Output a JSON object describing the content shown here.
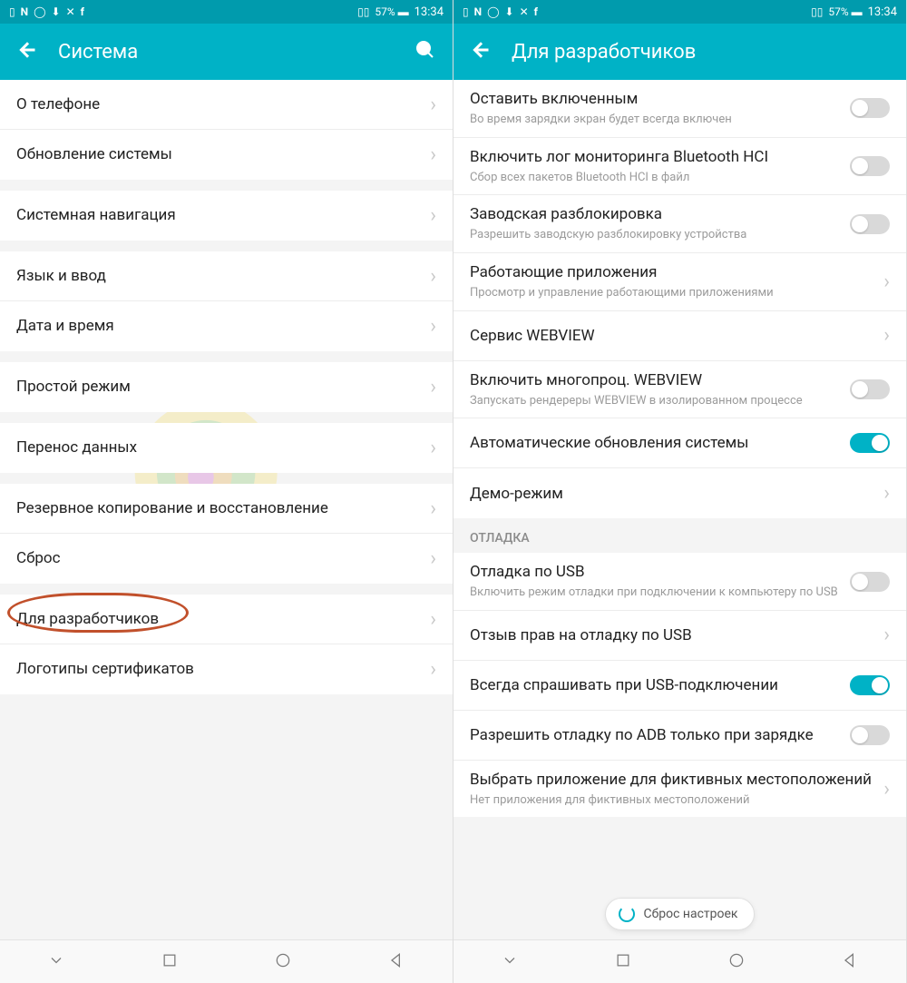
{
  "status": {
    "battery": "57%",
    "time": "13:34"
  },
  "left": {
    "appbar_title": "Система",
    "items": [
      {
        "label": "О телефоне"
      },
      {
        "label": "Обновление системы"
      }
    ],
    "items2": [
      {
        "label": "Системная навигация"
      }
    ],
    "items3": [
      {
        "label": "Язык и ввод"
      },
      {
        "label": "Дата и время"
      }
    ],
    "items4": [
      {
        "label": "Простой режим"
      }
    ],
    "items5": [
      {
        "label": "Перенос данных"
      }
    ],
    "items6": [
      {
        "label": "Резервное копирование и восстановление"
      },
      {
        "label": "Сброс"
      }
    ],
    "items7": [
      {
        "label": "Для разработчиков",
        "circled": true
      },
      {
        "label": "Логотипы сертификатов"
      }
    ]
  },
  "right": {
    "appbar_title": "Для разработчиков",
    "rows1": [
      {
        "label": "Оставить включенным",
        "sub": "Во время зарядки экран будет всегда включен",
        "toggle": false
      },
      {
        "label": "Включить лог мониторинга Bluetooth HCI",
        "sub": "Сбор всех пакетов Bluetooth HCI в файл",
        "toggle": false
      },
      {
        "label": "Заводская разблокировка",
        "sub": "Разрешить заводскую разблокировку устройства",
        "toggle": false
      },
      {
        "label": "Работающие приложения",
        "sub": "Просмотр и управление работающими приложениями",
        "chevron": true
      },
      {
        "label": "Сервис WEBVIEW",
        "chevron": true
      },
      {
        "label": "Включить многопроц. WEBVIEW",
        "sub": "Запускать рендереры WEBVIEW в изолированном процессе",
        "toggle": false
      },
      {
        "label": "Автоматические обновления системы",
        "toggle": true
      },
      {
        "label": "Демо-режим",
        "chevron": true
      }
    ],
    "section_debug": "ОТЛАДКА",
    "rows2": [
      {
        "label": "Отладка по USB",
        "sub": "Включить режим отладки при подключении к компьютеру по USB",
        "toggle": false
      },
      {
        "label": "Отзыв прав на отладку по USB",
        "chevron": true
      },
      {
        "label": "Всегда спрашивать при USB-подключении",
        "toggle": true
      },
      {
        "label": "Разрешить отладку по ADB только при зарядке",
        "toggle": false
      },
      {
        "label": "Выбрать приложение для фиктивных местоположений",
        "sub": "Нет приложения для фиктивных местоположений",
        "chevron": true
      }
    ],
    "chip_label": "Сброс настроек"
  }
}
